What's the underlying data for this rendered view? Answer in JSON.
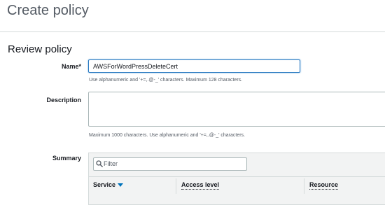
{
  "page": {
    "title": "Create policy"
  },
  "review": {
    "heading": "Review policy",
    "name_label": "Name*",
    "name_value": "AWSForWordPressDeleteCert",
    "name_hint": "Use alphanumeric and '+=,.@-_' characters. Maximum 128 characters.",
    "description_label": "Description",
    "description_value": "",
    "description_hint": "Maximum 1000 characters. Use alphanumeric and '+=,.@-_' characters.",
    "summary_label": "Summary"
  },
  "summary": {
    "filter_placeholder": "Filter",
    "columns": [
      "Service",
      "Access level",
      "Resource"
    ]
  },
  "colors": {
    "accent": "#2a7ac1",
    "sort_arrow": "#0073bb"
  },
  "icons": {
    "filter": "search-icon",
    "sort": "caret-down-icon"
  }
}
